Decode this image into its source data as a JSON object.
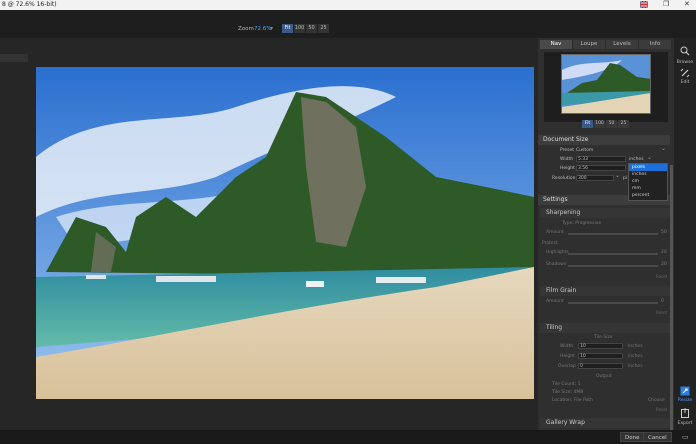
{
  "window": {
    "title": "8 @ 72.6% 16-bit)",
    "flag_icon": "flag-icon",
    "restore_icon": "restore-icon",
    "close_icon": "close-icon"
  },
  "zoom": {
    "label": "Zoom",
    "value": "72.6%",
    "buttons": [
      "Fit",
      "100",
      "50",
      "25"
    ]
  },
  "panel": {
    "tabs": [
      "Nav",
      "Loupe",
      "Levels",
      "Info"
    ],
    "thumb_zoom": [
      "Fit",
      "100",
      "50",
      "25"
    ],
    "document_size": {
      "title": "Document Size",
      "preset_label": "Preset",
      "preset_value": "Custom",
      "width_label": "Width",
      "width_value": "5.33",
      "height_label": "Height",
      "height_value": "3.56",
      "resolution_label": "Resolution",
      "resolution_value": "300",
      "unit_value": "inches",
      "res_unit": "pi",
      "dropdown_options": [
        "pixels",
        "inches",
        "cm",
        "mm",
        "percent"
      ]
    },
    "settings": {
      "title": "Settings",
      "sharpening": {
        "title": "Sharpening",
        "type_label": "Type: Progressive",
        "amount": "Amount",
        "protect": "Protect",
        "highlights": "Highlights",
        "shadows": "Shadows",
        "v1": "50",
        "v2": "20",
        "v3": "20",
        "reset": "Reset"
      },
      "film_grain": {
        "title": "Film Grain",
        "amount": "Amount",
        "v": "0",
        "reset": "Reset"
      },
      "tiling": {
        "title": "Tiling",
        "tile_size": "Tile Size",
        "width": "Width",
        "height": "Height",
        "overlap": "Overlap",
        "w": "10",
        "h": "10",
        "o": "0",
        "unit": "inches",
        "output": "Output",
        "tile_count": "Tile Count: 1",
        "tile_size_px": "Tile Size: 4MB",
        "location": "Location: File Path",
        "choose": "Choose",
        "reset": "Reset"
      },
      "gallery_wrap": {
        "title": "Gallery Wrap"
      }
    }
  },
  "rightbar": {
    "browse": "Browse",
    "edit": "Edit",
    "resize": "Resize",
    "export": "Export"
  },
  "footer": {
    "done": "Done",
    "cancel": "Cancel"
  }
}
